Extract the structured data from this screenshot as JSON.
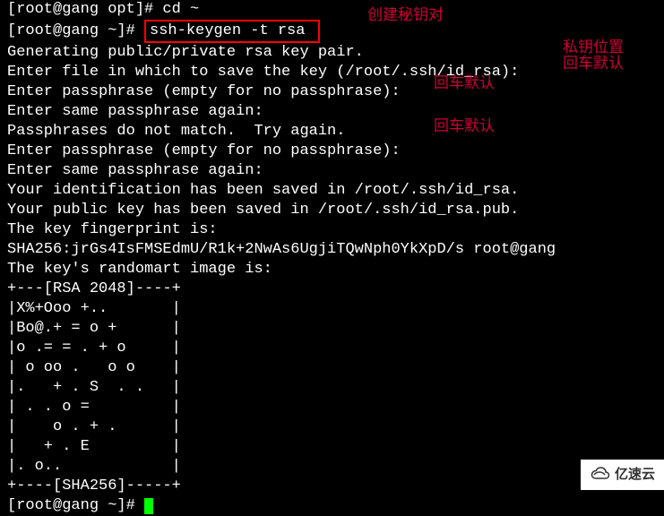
{
  "terminal": {
    "line_truncated": "[root@gang opt]# cd ~",
    "prompt1": "[root@gang ~]# ",
    "command": "ssh-keygen -t rsa ",
    "prompt2": "[root@gang ~]# ",
    "output": [
      "Generating public/private rsa key pair.",
      "Enter file in which to save the key (/root/.ssh/id_rsa):",
      "Enter passphrase (empty for no passphrase):",
      "Enter same passphrase again:",
      "Passphrases do not match.  Try again.",
      "Enter passphrase (empty for no passphrase):",
      "Enter same passphrase again:",
      "Your identification has been saved in /root/.ssh/id_rsa.",
      "Your public key has been saved in /root/.ssh/id_rsa.pub.",
      "The key fingerprint is:",
      "SHA256:jrGs4IsFMSEdmU/R1k+2NwAs6UgjiTQwNph0YkXpD/s root@gang",
      "The key's randomart image is:",
      "+---[RSA 2048]----+",
      "|X%+Ooo +..       |",
      "|Bo@.+ = o +      |",
      "|o .= = . + o     |",
      "| o oo .   o o    |",
      "|.   + . S  . .   |",
      "| . . o =         |",
      "|    o . + .      |",
      "|   + . E         |",
      "|. o..            |",
      "+----[SHA256]-----+"
    ]
  },
  "annotations": {
    "create_keypair": "创建秘钥对",
    "private_key_location": "私钥位置",
    "enter_default_1": "回车默认",
    "enter_default_2": "回车默认",
    "enter_default_3": "回车默认"
  },
  "watermark": {
    "text": "亿速云"
  }
}
